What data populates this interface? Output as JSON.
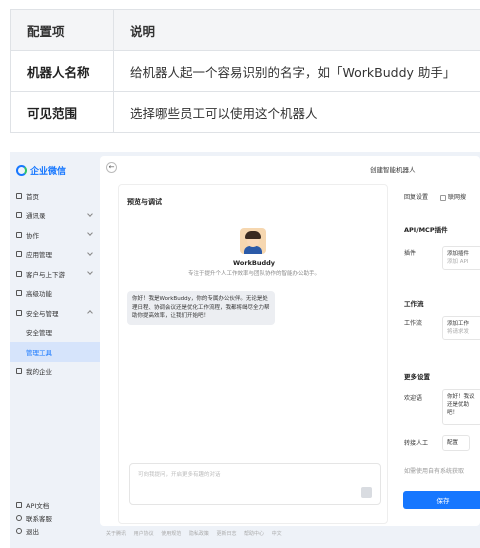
{
  "table": {
    "headers": [
      "配置项",
      "说明"
    ],
    "rows": [
      {
        "key": "机器人名称",
        "value": "给机器人起一个容易识别的名字，如「WorkBuddy 助手」"
      },
      {
        "key": "可见范围",
        "value": "选择哪些员工可以使用这个机器人"
      }
    ]
  },
  "app": {
    "logo": "企业微信",
    "page_title": "创建智能机器人",
    "nav": [
      {
        "label": "首页"
      },
      {
        "label": "通讯录"
      },
      {
        "label": "协作"
      },
      {
        "label": "应用管理"
      },
      {
        "label": "客户与上下游"
      },
      {
        "label": "高级功能"
      },
      {
        "label": "安全与管理"
      },
      {
        "label": "安全管理"
      },
      {
        "label": "管理工具"
      },
      {
        "label": "我的企业"
      }
    ],
    "bottom_links": [
      "API文档",
      "联系客服",
      "退出"
    ],
    "preview": {
      "title": "预览与调试",
      "bot_name": "WorkBuddy",
      "bot_desc": "专注于提升个人工作效率与团队协作的智能办公助手。",
      "greeting": "你好！我是WorkBuddy，你的专属办公伙伴。无论是处理日程、协调会议还是优化工作流程，我都将竭尽全力帮助你提高效率，让我们开始吧！",
      "input_placeholder": "可向我提问，开启更多有趣的对话"
    },
    "settings": {
      "reply_label": "回复设置",
      "network_label": "联网搜",
      "api_section": "API/MCP插件",
      "plugin_label": "插件",
      "plugin_btn": "添加插件",
      "plugin_sub": "添加 API",
      "workflow_section": "工作流",
      "workflow_label": "工作流",
      "workflow_btn": "添加工作",
      "workflow_sub": "将请求发",
      "more_section": "更多设置",
      "welcome_label": "欢迎语",
      "welcome_text": "你好！我议还是优助吧！",
      "transfer_label": "转接人工",
      "transfer_btn": "配置",
      "sync_hint": "如需使用自有系统获取",
      "save_btn": "保存"
    },
    "footer": [
      "关于腾讯",
      "用户协议",
      "使用规范",
      "隐私政策",
      "更新日志",
      "帮助中心",
      "中文"
    ]
  }
}
